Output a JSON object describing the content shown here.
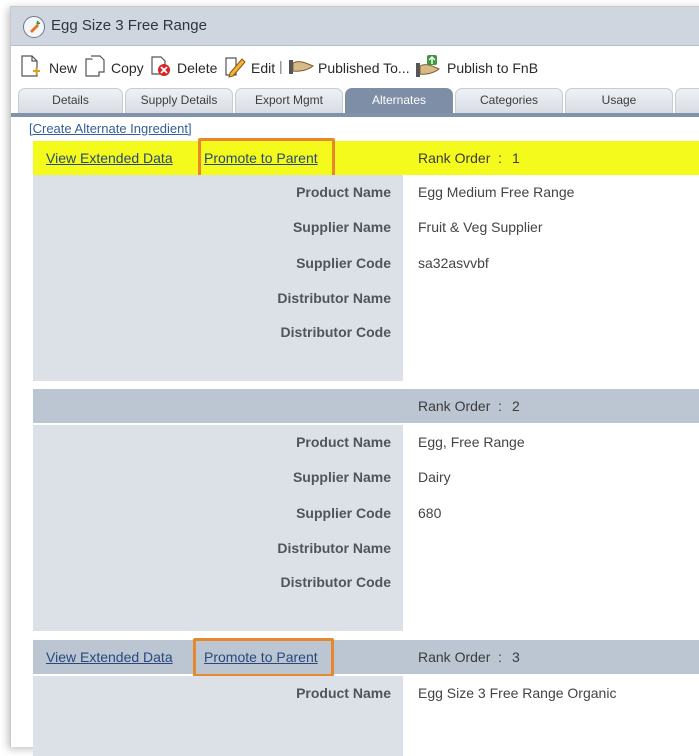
{
  "window": {
    "title": "Egg Size 3 Free Range"
  },
  "toolbar": {
    "new_label": "New",
    "copy_label": "Copy",
    "delete_label": "Delete",
    "edit_label": "Edit",
    "separator": "|",
    "published_label": "Published To...",
    "publish_fnb_label": "Publish to FnB"
  },
  "tabs": [
    "Details",
    "Supply Details",
    "Export Mgmt",
    "Alternates",
    "Categories",
    "Usage"
  ],
  "active_tab": "Alternates",
  "create_link": "[Create Alternate Ingredient]",
  "links": {
    "view_extended": "View Extended Data",
    "promote": "Promote to Parent"
  },
  "rank_label": "Rank Order",
  "rank_colon": ":",
  "field_labels": {
    "product": "Product Name",
    "supplier": "Supplier Name",
    "supplier_code": "Supplier Code",
    "distributor": "Distributor Name",
    "distributor_code": "Distributor Code"
  },
  "alternates": [
    {
      "rank": "1",
      "product_name": "Egg Medium Free Range",
      "supplier_name": "Fruit & Veg Supplier",
      "supplier_code": "sa32asvvbf",
      "distributor_name": "",
      "distributor_code": ""
    },
    {
      "rank": "2",
      "product_name": "Egg, Free Range",
      "supplier_name": "Dairy",
      "supplier_code": "680",
      "distributor_name": "",
      "distributor_code": ""
    },
    {
      "rank": "3",
      "product_name": "Egg Size 3 Free Range Organic"
    }
  ],
  "colors": {
    "highlight": "#f4fa1b",
    "rank_bar": "#bcc5d2",
    "label_column": "#dce1e8",
    "active_tab": "#7d8ea6",
    "callout": "#e8882e",
    "link": "#27497b"
  },
  "icons": {
    "title": "carrot-icon",
    "new": "new-document-icon",
    "copy": "copy-icon",
    "delete": "delete-icon",
    "edit": "edit-pencil-icon",
    "published": "published-hand-icon",
    "publish_fnb": "publish-fnb-icon"
  }
}
